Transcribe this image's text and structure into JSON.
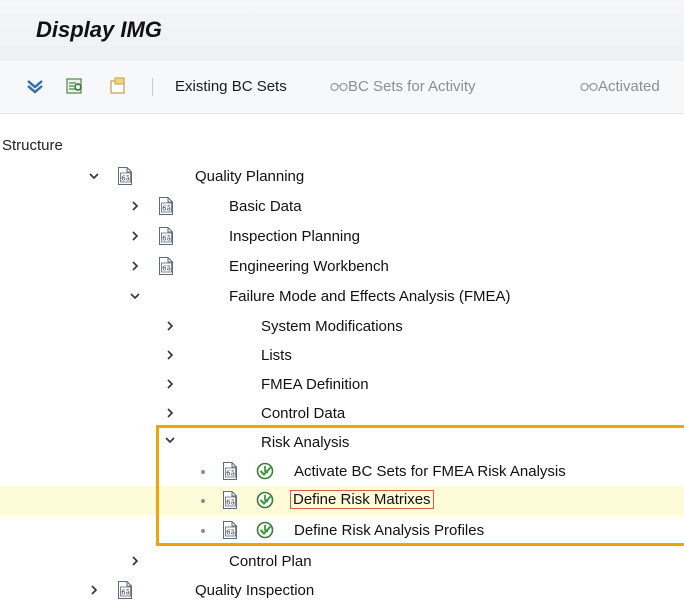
{
  "title": "Display IMG",
  "toolbar": {
    "existing_bc_sets": "Existing BC Sets",
    "bc_sets_for_activity": "BC Sets for Activity",
    "activated": "Activated"
  },
  "structure_label": "Structure",
  "tree": [
    {
      "label": "Quality Planning",
      "state": "expanded",
      "icon": "document-icon"
    },
    {
      "label": "Basic Data",
      "state": "collapsed",
      "icon": "document-icon"
    },
    {
      "label": "Inspection Planning",
      "state": "collapsed",
      "icon": "document-icon"
    },
    {
      "label": "Engineering Workbench",
      "state": "collapsed",
      "icon": "document-icon"
    },
    {
      "label": "Failure Mode and Effects Analysis (FMEA)",
      "state": "expanded"
    },
    {
      "label": "System Modifications",
      "state": "collapsed"
    },
    {
      "label": "Lists",
      "state": "collapsed"
    },
    {
      "label": "FMEA Definition",
      "state": "collapsed"
    },
    {
      "label": "Control Data",
      "state": "collapsed"
    },
    {
      "label": "Risk Analysis",
      "state": "expanded"
    },
    {
      "label": "Activate BC Sets for FMEA Risk Analysis",
      "state": "leaf",
      "icon": "document-icon"
    },
    {
      "label": "Define Risk Matrixes",
      "state": "leaf",
      "icon": "document-icon",
      "selected": true
    },
    {
      "label": "Define Risk Analysis Profiles",
      "state": "leaf",
      "icon": "document-icon"
    },
    {
      "label": "Control Plan",
      "state": "collapsed"
    },
    {
      "label": "Quality Inspection",
      "state": "collapsed",
      "icon": "document-icon"
    }
  ],
  "colors": {
    "highlight_frame": "#f0a30a",
    "selected_row": "#fdfbd8",
    "focus_box": "#e05a4a"
  }
}
